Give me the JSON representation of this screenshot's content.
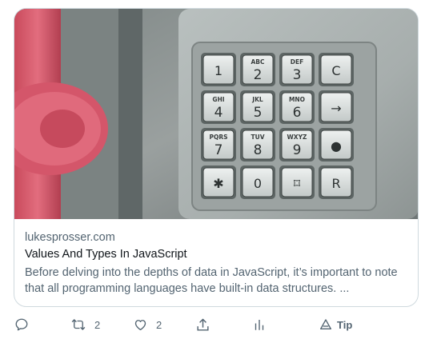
{
  "card": {
    "image_alt": "Payphone keypad with red handset",
    "domain": "lukesprosser.com",
    "title": "Values And Types In JavaScript",
    "description": "Before delving into the depths of data in JavaScript, it’s important to note that all programming languages have built-in data structures. ..."
  },
  "keypad": {
    "keys": [
      {
        "digit": "1",
        "letters": ""
      },
      {
        "digit": "2",
        "letters": "ABC"
      },
      {
        "digit": "3",
        "letters": "DEF"
      },
      {
        "digit": "C",
        "letters": ""
      },
      {
        "digit": "4",
        "letters": "GHI"
      },
      {
        "digit": "5",
        "letters": "JKL"
      },
      {
        "digit": "6",
        "letters": "MNO"
      },
      {
        "digit": "→",
        "letters": ""
      },
      {
        "digit": "7",
        "letters": "PQRS"
      },
      {
        "digit": "8",
        "letters": "TUV"
      },
      {
        "digit": "9",
        "letters": "WXYZ"
      },
      {
        "digit": "●",
        "letters": ""
      },
      {
        "digit": "✱",
        "letters": ""
      },
      {
        "digit": "0",
        "letters": ""
      },
      {
        "digit": "⌑",
        "letters": ""
      },
      {
        "digit": "R",
        "letters": ""
      }
    ]
  },
  "actions": {
    "reply": {
      "icon": "reply-icon",
      "count": ""
    },
    "retweet": {
      "icon": "retweet-icon",
      "count": "2"
    },
    "like": {
      "icon": "heart-icon",
      "count": "2"
    },
    "share": {
      "icon": "share-icon",
      "count": ""
    },
    "analytics": {
      "icon": "analytics-icon",
      "count": ""
    },
    "tip": {
      "icon": "tip-icon",
      "label": "Tip"
    }
  },
  "colors": {
    "text_primary": "#0f1419",
    "text_secondary": "#536471",
    "border": "#cfd9de",
    "handset_red": "#d9566a"
  }
}
